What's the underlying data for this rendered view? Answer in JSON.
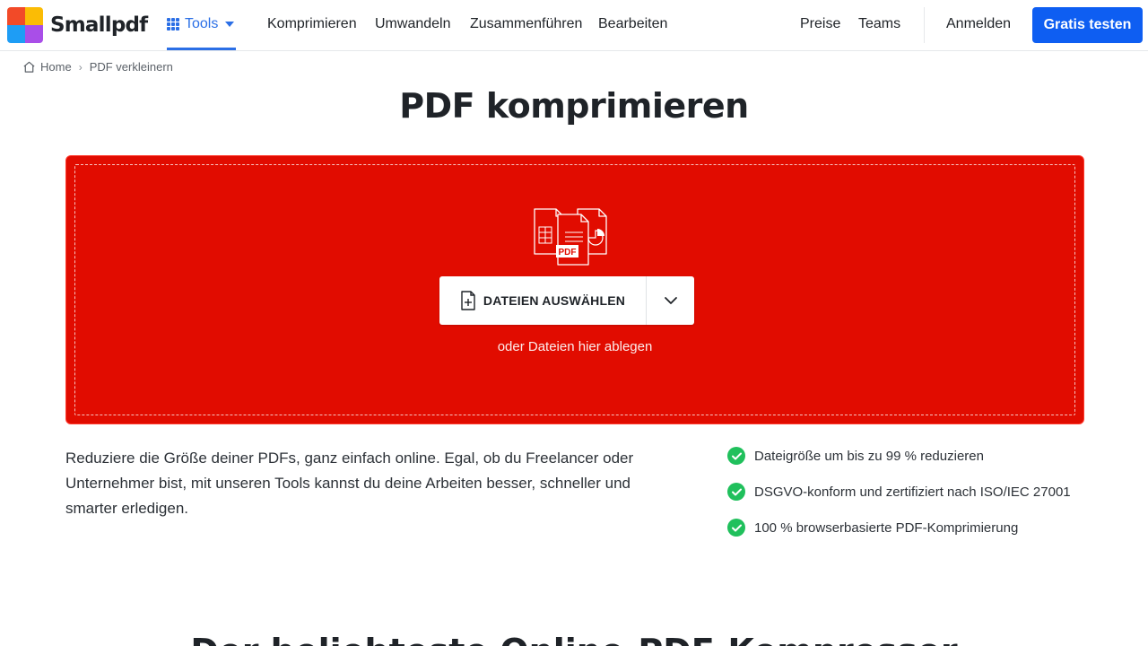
{
  "brand": {
    "name": "Smallpdf",
    "logo_colors": [
      "#f24a28",
      "#fbbc05",
      "#1e9df5",
      "#a94ee8"
    ]
  },
  "header": {
    "tools_label": "Tools",
    "nav": [
      "Komprimieren",
      "Umwandeln",
      "Zusammenführen",
      "Bearbeiten"
    ],
    "right_nav": [
      "Preise",
      "Teams"
    ],
    "login_label": "Anmelden",
    "cta_label": "Gratis testen"
  },
  "breadcrumb": {
    "home": "Home",
    "current": "PDF verkleinern"
  },
  "main": {
    "title": "PDF komprimieren",
    "choose_button": "DATEIEN AUSWÄHLEN",
    "drop_hint": "oder Dateien hier ablegen",
    "illustration_label": "PDF",
    "intro": "Reduziere die Größe deiner PDFs, ganz einfach online. Egal, ob du Freelancer oder Unternehmer bist, mit unseren Tools kannst du deine Arbeiten besser, schneller und smarter erledigen.",
    "features": [
      "Dateigröße um bis zu 99 % reduzieren",
      "DSGVO-konform und zertifiziert nach ISO/IEC 27001",
      "100 % browserbasierte PDF-Komprimierung"
    ],
    "bottom_heading": "Der beliebteste Online-PDF-Kompressor"
  },
  "colors": {
    "accent": "#0e5ef2",
    "tools_blue": "#2b6fe6",
    "dropzone_red": "#e10c00",
    "check_green": "#20c05c"
  }
}
